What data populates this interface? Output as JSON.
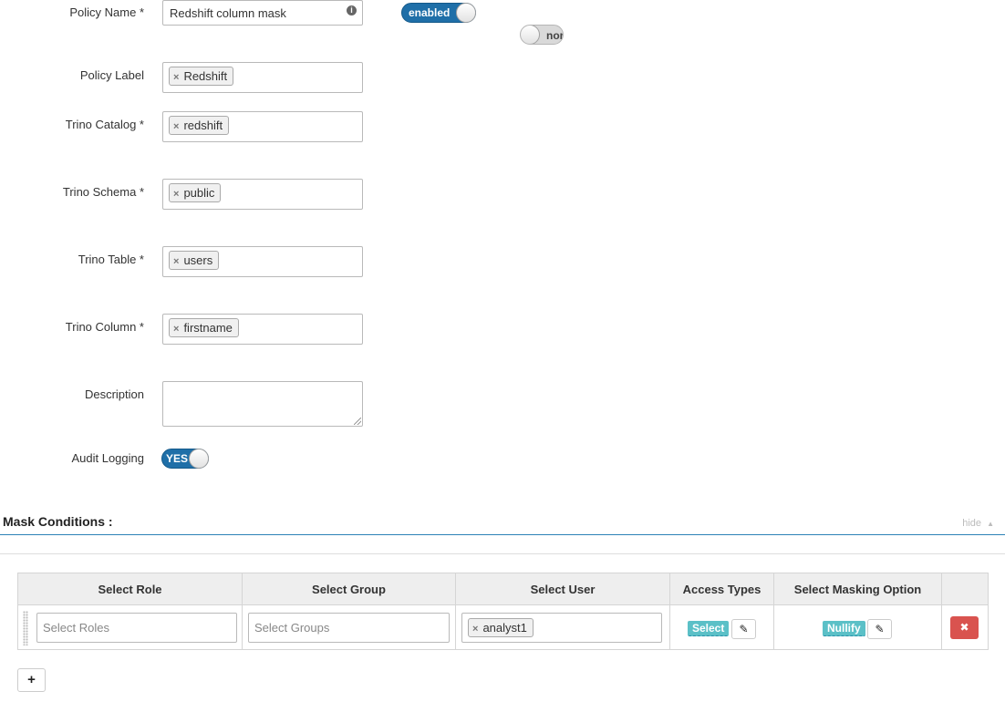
{
  "form": {
    "policy_name": {
      "label": "Policy Name *",
      "value": "Redshift column mask",
      "info_icon": "info-icon"
    },
    "enabled_toggle": "enabled",
    "override_toggle": "nor",
    "policy_label": {
      "label": "Policy Label",
      "tag": "Redshift"
    },
    "catalog": {
      "label": "Trino Catalog *",
      "tag": "redshift"
    },
    "schema": {
      "label": "Trino Schema *",
      "tag": "public"
    },
    "table": {
      "label": "Trino Table *",
      "tag": "users"
    },
    "column": {
      "label": "Trino Column *",
      "tag": "firstname"
    },
    "description": {
      "label": "Description",
      "value": ""
    },
    "audit": {
      "label": "Audit Logging",
      "toggle": "YES"
    }
  },
  "mask_conditions": {
    "title": "Mask Conditions :",
    "hide_label": "hide",
    "columns": [
      "Select Role",
      "Select Group",
      "Select User",
      "Access Types",
      "Select Masking Option",
      ""
    ],
    "row": {
      "roles_placeholder": "Select Roles",
      "groups_placeholder": "Select Groups",
      "user_tag": "analyst1",
      "access_type": "Select",
      "masking_option": "Nullify"
    }
  },
  "colors": {
    "toggle_on": "#1f6fa8",
    "badge": "#5bc0c7",
    "delete": "#d9534f",
    "section_rule": "#2d82b7"
  },
  "icons": [
    "info-icon",
    "remove-tag-icon",
    "pencil-icon",
    "delete-icon",
    "plus-icon",
    "drag-handle-icon",
    "chevron-up-icon"
  ]
}
